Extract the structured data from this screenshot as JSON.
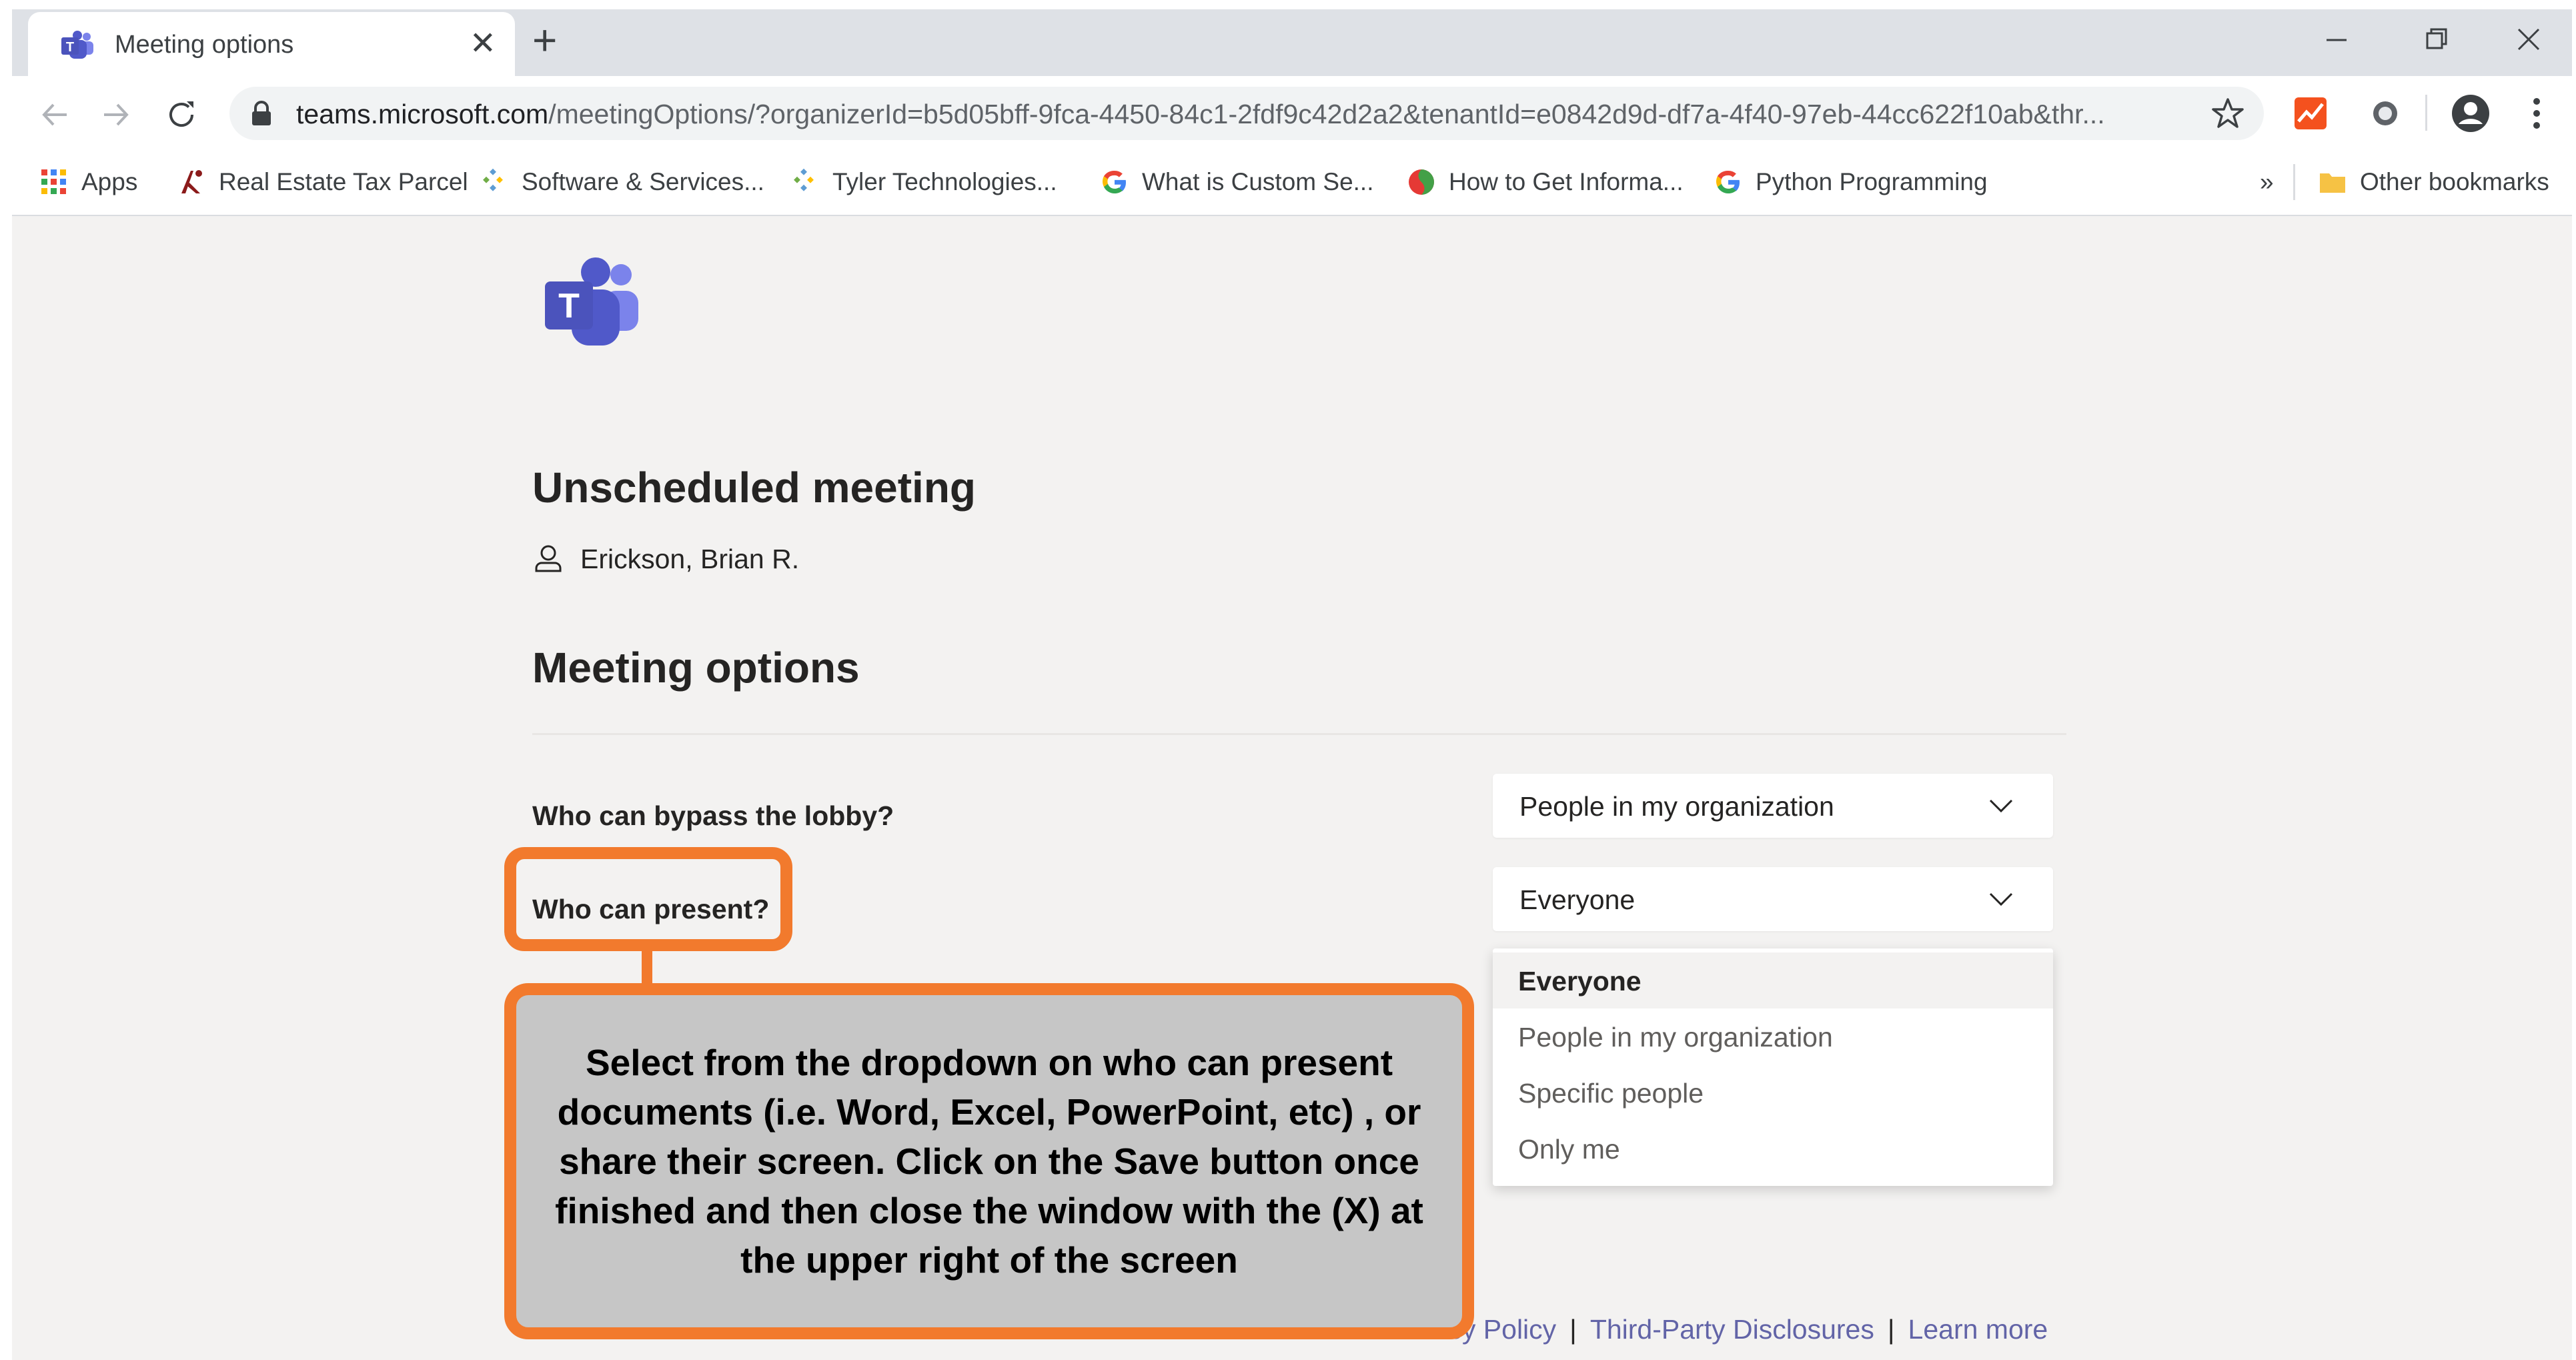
{
  "browser": {
    "tab_title": "Meeting options",
    "url_host": "teams.microsoft.com",
    "url_path": "/meetingOptions/?organizerId=b5d05bff-9fca-4450-84c1-2fdf9c42d2a2&tenantId=e0842d9d-df7a-4f40-97eb-44cc622f10ab&thr...",
    "bookmarks": [
      {
        "label": "Apps",
        "icon": "apps-grid-icon"
      },
      {
        "label": "Real Estate Tax Parcel",
        "icon": "tax-parcel-icon"
      },
      {
        "label": "Software & Services...",
        "icon": "software-services-icon"
      },
      {
        "label": "Tyler Technologies...",
        "icon": "tyler-tech-icon"
      },
      {
        "label": "What is Custom Se...",
        "icon": "google-icon"
      },
      {
        "label": "How to Get Informa...",
        "icon": "how-to-icon"
      },
      {
        "label": "Python Programming",
        "icon": "google-icon"
      }
    ],
    "overflow_label": "»",
    "other_bookmarks_label": "Other bookmarks"
  },
  "meeting": {
    "title": "Unscheduled meeting",
    "organizer": "Erickson, Brian R."
  },
  "options": {
    "heading": "Meeting options",
    "bypass_lobby": {
      "label": "Who can bypass the lobby?",
      "value": "People in my organization"
    },
    "who_can_present": {
      "label": "Who can present?",
      "value": "Everyone"
    }
  },
  "dropdown": {
    "items": [
      "Everyone",
      "People in my organization",
      "Specific people",
      "Only me"
    ],
    "selected": "Everyone"
  },
  "callout": {
    "text": "Select from the dropdown on who can present documents (i.e. Word, Excel, PowerPoint, etc) , or share their screen.  Click on the Save button once finished and then close the window with the (X) at the upper right of the screen"
  },
  "footer": {
    "links": [
      "Privacy Policy",
      "Third-Party Disclosures",
      "Learn more"
    ],
    "separator": "|"
  },
  "colors": {
    "accent": "#6264a7",
    "callout_border": "#f27a2d",
    "callout_fill": "#c6c6c6",
    "page_bg": "#f3f2f1"
  }
}
